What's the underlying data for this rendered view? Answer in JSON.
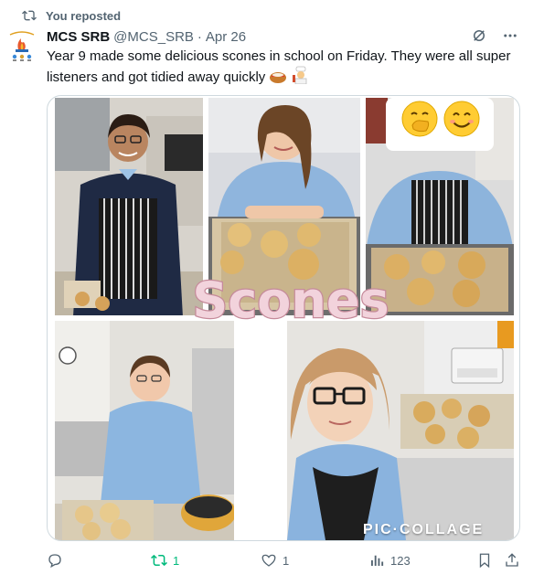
{
  "repost": {
    "label": "You reposted",
    "icon": "repost-icon"
  },
  "author": {
    "name": "MCS SRB",
    "handle": "@MCS_SRB",
    "separator": "·",
    "date": "Apr 26",
    "avatar_icon": "school-logo-icon"
  },
  "header_actions": [
    {
      "icon": "grok-icon"
    },
    {
      "icon": "more-icon"
    }
  ],
  "tweet": {
    "line1": "Year 9 made some delicious scones in school on Friday. They were all super",
    "line2": "listeners and got tidied away quickly",
    "emoji": [
      "scone-emoji",
      "cook-emoji"
    ]
  },
  "media": {
    "overlay_title": "Scones",
    "watermark": "PIC·COLLAGE",
    "photo_emoji": [
      "hand-over-mouth-emoji",
      "smiling-face-emoji"
    ]
  },
  "actions": {
    "reply": {
      "icon": "reply-icon",
      "count": ""
    },
    "repost": {
      "icon": "repost-icon",
      "count": "1"
    },
    "like": {
      "icon": "heart-icon",
      "count": "1"
    },
    "views": {
      "icon": "views-icon",
      "count": "123"
    },
    "bookmark": {
      "icon": "bookmark-icon"
    },
    "share": {
      "icon": "share-icon"
    }
  },
  "colors": {
    "text": "#0f1419",
    "secondary": "#536471",
    "repost_green": "#00ba7c",
    "border": "#cfd9de"
  }
}
